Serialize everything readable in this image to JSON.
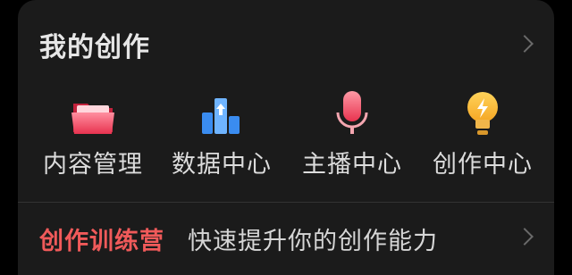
{
  "section": {
    "title": "我的创作"
  },
  "tools": [
    {
      "label": "内容管理",
      "icon": "folder-icon"
    },
    {
      "label": "数据中心",
      "icon": "data-chart-icon"
    },
    {
      "label": "主播中心",
      "icon": "microphone-icon"
    },
    {
      "label": "创作中心",
      "icon": "lightbulb-icon"
    }
  ],
  "banner": {
    "title": "创作训练营",
    "subtitle": "快速提升你的创作能力"
  },
  "colors": {
    "background": "#000000",
    "card": "#1b1b1b",
    "accent_red": "#f05a5a"
  }
}
